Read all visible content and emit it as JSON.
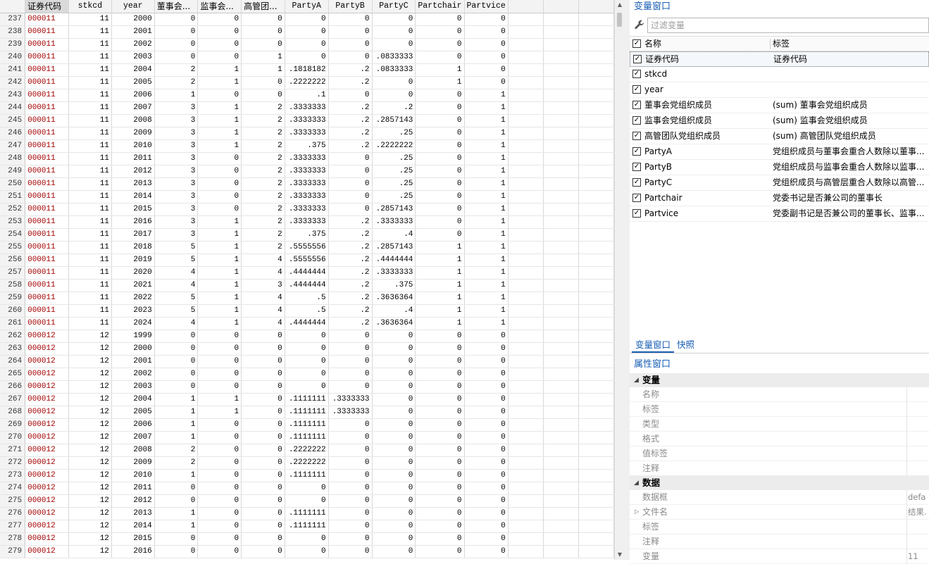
{
  "grid": {
    "columns": [
      "证券代码",
      "stkcd",
      "year",
      "董事会...",
      "监事会...",
      "高管团...",
      "PartyA",
      "PartyB",
      "PartyC",
      "Partchair",
      "Partvice"
    ],
    "rows": [
      [
        "237",
        "000011",
        "11",
        "2000",
        "0",
        "0",
        "0",
        "0",
        "0",
        "0",
        "0",
        "0"
      ],
      [
        "238",
        "000011",
        "11",
        "2001",
        "0",
        "0",
        "0",
        "0",
        "0",
        "0",
        "0",
        "0"
      ],
      [
        "239",
        "000011",
        "11",
        "2002",
        "0",
        "0",
        "0",
        "0",
        "0",
        "0",
        "0",
        "0"
      ],
      [
        "240",
        "000011",
        "11",
        "2003",
        "0",
        "0",
        "1",
        "0",
        "0",
        ".0833333",
        "0",
        "0"
      ],
      [
        "241",
        "000011",
        "11",
        "2004",
        "2",
        "1",
        "1",
        ".1818182",
        ".2",
        ".0833333",
        "1",
        "0"
      ],
      [
        "242",
        "000011",
        "11",
        "2005",
        "2",
        "1",
        "0",
        ".2222222",
        ".2",
        "0",
        "1",
        "0"
      ],
      [
        "243",
        "000011",
        "11",
        "2006",
        "1",
        "0",
        "0",
        ".1",
        "0",
        "0",
        "0",
        "1"
      ],
      [
        "244",
        "000011",
        "11",
        "2007",
        "3",
        "1",
        "2",
        ".3333333",
        ".2",
        ".2",
        "0",
        "1"
      ],
      [
        "245",
        "000011",
        "11",
        "2008",
        "3",
        "1",
        "2",
        ".3333333",
        ".2",
        ".2857143",
        "0",
        "1"
      ],
      [
        "246",
        "000011",
        "11",
        "2009",
        "3",
        "1",
        "2",
        ".3333333",
        ".2",
        ".25",
        "0",
        "1"
      ],
      [
        "247",
        "000011",
        "11",
        "2010",
        "3",
        "1",
        "2",
        ".375",
        ".2",
        ".2222222",
        "0",
        "1"
      ],
      [
        "248",
        "000011",
        "11",
        "2011",
        "3",
        "0",
        "2",
        ".3333333",
        "0",
        ".25",
        "0",
        "1"
      ],
      [
        "249",
        "000011",
        "11",
        "2012",
        "3",
        "0",
        "2",
        ".3333333",
        "0",
        ".25",
        "0",
        "1"
      ],
      [
        "250",
        "000011",
        "11",
        "2013",
        "3",
        "0",
        "2",
        ".3333333",
        "0",
        ".25",
        "0",
        "1"
      ],
      [
        "251",
        "000011",
        "11",
        "2014",
        "3",
        "0",
        "2",
        ".3333333",
        "0",
        ".25",
        "0",
        "1"
      ],
      [
        "252",
        "000011",
        "11",
        "2015",
        "3",
        "0",
        "2",
        ".3333333",
        "0",
        ".2857143",
        "0",
        "1"
      ],
      [
        "253",
        "000011",
        "11",
        "2016",
        "3",
        "1",
        "2",
        ".3333333",
        ".2",
        ".3333333",
        "0",
        "1"
      ],
      [
        "254",
        "000011",
        "11",
        "2017",
        "3",
        "1",
        "2",
        ".375",
        ".2",
        ".4",
        "0",
        "1"
      ],
      [
        "255",
        "000011",
        "11",
        "2018",
        "5",
        "1",
        "2",
        ".5555556",
        ".2",
        ".2857143",
        "1",
        "1"
      ],
      [
        "256",
        "000011",
        "11",
        "2019",
        "5",
        "1",
        "4",
        ".5555556",
        ".2",
        ".4444444",
        "1",
        "1"
      ],
      [
        "257",
        "000011",
        "11",
        "2020",
        "4",
        "1",
        "4",
        ".4444444",
        ".2",
        ".3333333",
        "1",
        "1"
      ],
      [
        "258",
        "000011",
        "11",
        "2021",
        "4",
        "1",
        "3",
        ".4444444",
        ".2",
        ".375",
        "1",
        "1"
      ],
      [
        "259",
        "000011",
        "11",
        "2022",
        "5",
        "1",
        "4",
        ".5",
        ".2",
        ".3636364",
        "1",
        "1"
      ],
      [
        "260",
        "000011",
        "11",
        "2023",
        "5",
        "1",
        "4",
        ".5",
        ".2",
        ".4",
        "1",
        "1"
      ],
      [
        "261",
        "000011",
        "11",
        "2024",
        "4",
        "1",
        "4",
        ".4444444",
        ".2",
        ".3636364",
        "1",
        "1"
      ],
      [
        "262",
        "000012",
        "12",
        "1999",
        "0",
        "0",
        "0",
        "0",
        "0",
        "0",
        "0",
        "0"
      ],
      [
        "263",
        "000012",
        "12",
        "2000",
        "0",
        "0",
        "0",
        "0",
        "0",
        "0",
        "0",
        "0"
      ],
      [
        "264",
        "000012",
        "12",
        "2001",
        "0",
        "0",
        "0",
        "0",
        "0",
        "0",
        "0",
        "0"
      ],
      [
        "265",
        "000012",
        "12",
        "2002",
        "0",
        "0",
        "0",
        "0",
        "0",
        "0",
        "0",
        "0"
      ],
      [
        "266",
        "000012",
        "12",
        "2003",
        "0",
        "0",
        "0",
        "0",
        "0",
        "0",
        "0",
        "0"
      ],
      [
        "267",
        "000012",
        "12",
        "2004",
        "1",
        "1",
        "0",
        ".1111111",
        ".3333333",
        "0",
        "0",
        "0"
      ],
      [
        "268",
        "000012",
        "12",
        "2005",
        "1",
        "1",
        "0",
        ".1111111",
        ".3333333",
        "0",
        "0",
        "0"
      ],
      [
        "269",
        "000012",
        "12",
        "2006",
        "1",
        "0",
        "0",
        ".1111111",
        "0",
        "0",
        "0",
        "0"
      ],
      [
        "270",
        "000012",
        "12",
        "2007",
        "1",
        "0",
        "0",
        ".1111111",
        "0",
        "0",
        "0",
        "0"
      ],
      [
        "271",
        "000012",
        "12",
        "2008",
        "2",
        "0",
        "0",
        ".2222222",
        "0",
        "0",
        "0",
        "0"
      ],
      [
        "272",
        "000012",
        "12",
        "2009",
        "2",
        "0",
        "0",
        ".2222222",
        "0",
        "0",
        "0",
        "0"
      ],
      [
        "273",
        "000012",
        "12",
        "2010",
        "1",
        "0",
        "0",
        ".1111111",
        "0",
        "0",
        "0",
        "0"
      ],
      [
        "274",
        "000012",
        "12",
        "2011",
        "0",
        "0",
        "0",
        "0",
        "0",
        "0",
        "0",
        "0"
      ],
      [
        "275",
        "000012",
        "12",
        "2012",
        "0",
        "0",
        "0",
        "0",
        "0",
        "0",
        "0",
        "0"
      ],
      [
        "276",
        "000012",
        "12",
        "2013",
        "1",
        "0",
        "0",
        ".1111111",
        "0",
        "0",
        "0",
        "0"
      ],
      [
        "277",
        "000012",
        "12",
        "2014",
        "1",
        "0",
        "0",
        ".1111111",
        "0",
        "0",
        "0",
        "0"
      ],
      [
        "278",
        "000012",
        "12",
        "2015",
        "0",
        "0",
        "0",
        "0",
        "0",
        "0",
        "0",
        "0"
      ],
      [
        "279",
        "000012",
        "12",
        "2016",
        "0",
        "0",
        "0",
        "0",
        "0",
        "0",
        "0",
        "0"
      ]
    ]
  },
  "variables_window": {
    "title": "变量窗口",
    "filter_placeholder": "过滤变量",
    "filter_icon": "wrench-icon",
    "header_name": "名称",
    "header_label": "标签",
    "items": [
      {
        "name": "证券代码",
        "label": "证券代码"
      },
      {
        "name": "stkcd",
        "label": ""
      },
      {
        "name": "year",
        "label": ""
      },
      {
        "name": "董事会党组织成员",
        "label": "(sum) 董事会党组织成员"
      },
      {
        "name": "监事会党组织成员",
        "label": "(sum) 监事会党组织成员"
      },
      {
        "name": "高管团队党组织成员",
        "label": "(sum) 高管团队党组织成员"
      },
      {
        "name": "PartyA",
        "label": "党组织成员与董事会重合人数除以董事..."
      },
      {
        "name": "PartyB",
        "label": "党组织成员与监事会重合人数除以监事..."
      },
      {
        "name": "PartyC",
        "label": "党组织成员与高管层重合人数除以高管..."
      },
      {
        "name": "Partchair",
        "label": "党委书记是否兼公司的董事长"
      },
      {
        "name": "Partvice",
        "label": "党委副书记是否兼公司的董事长、监事..."
      }
    ]
  },
  "tabs": [
    "变量窗口",
    "快照"
  ],
  "properties_window": {
    "title": "属性窗口",
    "groups": [
      {
        "name": "变量",
        "rows": [
          {
            "name": "名称",
            "value": ""
          },
          {
            "name": "标签",
            "value": ""
          },
          {
            "name": "类型",
            "value": ""
          },
          {
            "name": "格式",
            "value": ""
          },
          {
            "name": "值标签",
            "value": ""
          },
          {
            "name": "注释",
            "value": ""
          }
        ]
      },
      {
        "name": "数据",
        "rows": [
          {
            "name": "数据框",
            "value": "defa"
          },
          {
            "name": "文件名",
            "value": "结果."
          },
          {
            "name": "标签",
            "value": ""
          },
          {
            "name": "注释",
            "value": ""
          },
          {
            "name": "变量",
            "value": "11"
          }
        ]
      }
    ]
  },
  "colors": {
    "accent": "#1a5fb4",
    "code_text": "#a30000"
  }
}
